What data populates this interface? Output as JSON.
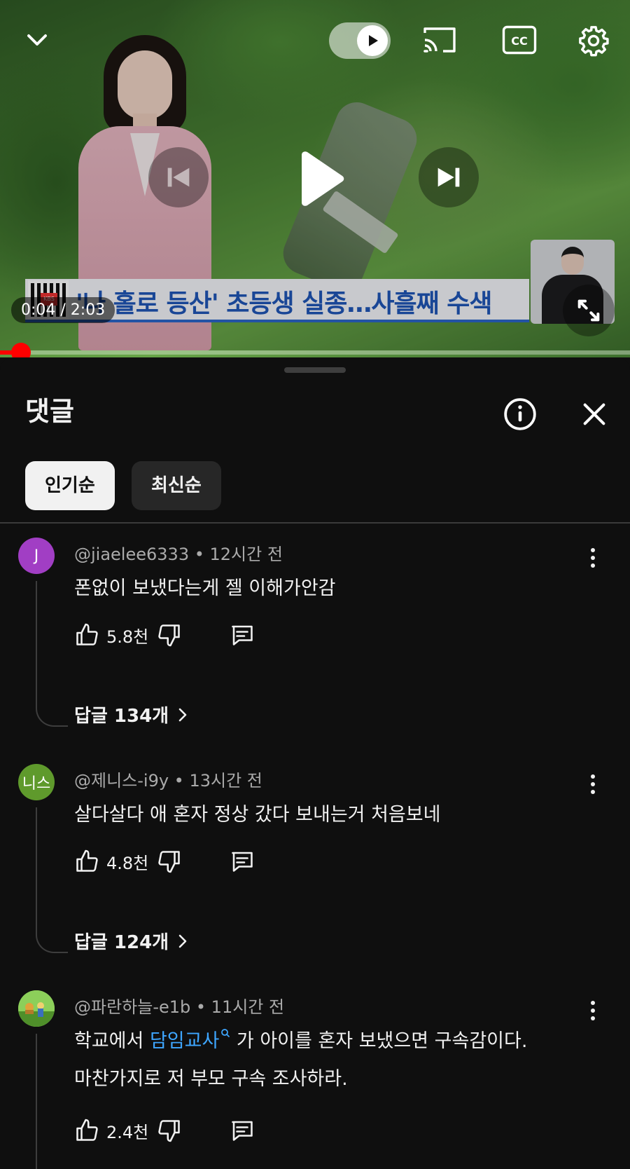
{
  "colors": {
    "background": "#0f0f0f",
    "accent_red": "#ff0000",
    "link_blue": "#3ea6ff",
    "text_primary": "#f1f1f1",
    "text_secondary": "#aaaaaa",
    "avatar_purple": "#a13ec4",
    "avatar_green": "#5f9a2c"
  },
  "player": {
    "channel_watermark": "KBS",
    "headline": "'나 홀로 등산' 초등생 실종…사흘째 수색",
    "time": "0:04 / 2:03",
    "progress_fraction": 0.033,
    "autoplay_on": true,
    "icons": {
      "collapse": "chevron-down-icon",
      "autoplay": "autoplay-toggle-icon",
      "cast": "cast-icon",
      "captions": "closed-captions-icon",
      "settings": "gear-icon",
      "previous": "skip-previous-icon",
      "play": "play-icon",
      "next": "skip-next-icon",
      "fullscreen": "fullscreen-icon"
    },
    "cc_label": "CC"
  },
  "comments_panel": {
    "title": "댓글",
    "sort_chips": [
      {
        "label": "인기순",
        "active": true
      },
      {
        "label": "최신순",
        "active": false
      }
    ],
    "comments": [
      {
        "avatar_initial": "J",
        "author": "@jiaelee6333",
        "time": "12시간 전",
        "text": "폰없이 보냈다는게 젤 이해가안감",
        "likes": "5.8천",
        "replies": "답글 134개"
      },
      {
        "avatar_initial": "니스",
        "author": "@제니스-i9y",
        "time": "13시간 전",
        "text": "살다살다 애 혼자 정상 갔다 보내는거 처음보네",
        "likes": "4.8천",
        "replies": "답글 124개"
      },
      {
        "avatar_initial": "",
        "author": "@파란하늘-e1b",
        "time": "11시간 전",
        "text_before_link": "학교에서 ",
        "text_link": "담임교사",
        "text_after_link": " 가 아이를 혼자 보냈으면 구속감이다.",
        "text_line2": "마찬가지로 저 부모 구속 조사하라.",
        "likes": "2.4천"
      }
    ],
    "meta_separator": " • "
  }
}
